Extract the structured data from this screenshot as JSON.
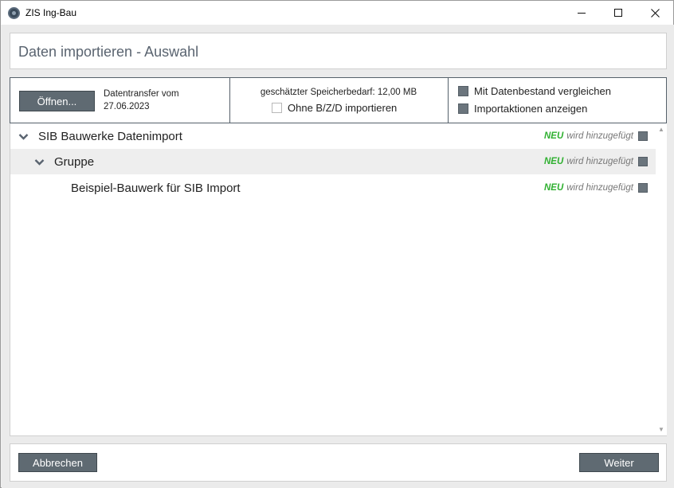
{
  "window": {
    "title": "ZIS Ing-Bau",
    "controls": [
      "minimize",
      "maximize",
      "close"
    ]
  },
  "header": {
    "title": "Daten importieren - Auswahl"
  },
  "toolbar": {
    "open_label": "Öffnen...",
    "transfer_label": "Datentransfer vom",
    "transfer_date": "27.06.2023",
    "storage_text": "geschätzter Speicherbedarf: 12,00 MB",
    "ohne_label": "Ohne B/Z/D importieren",
    "ohne_checked": false,
    "compare_label": "Mit Datenbestand vergleichen",
    "compare_checked": true,
    "actions_label": "Importaktionen anzeigen",
    "actions_checked": true
  },
  "tree": {
    "rows": [
      {
        "label": "SIB Bauwerke Datenimport",
        "level": 0,
        "expanded": true,
        "badge": "NEU",
        "status": "wird hinzugefügt",
        "checked": true
      },
      {
        "label": "Gruppe",
        "level": 1,
        "expanded": true,
        "badge": "NEU",
        "status": "wird hinzugefügt",
        "checked": true
      },
      {
        "label": "Beispiel-Bauwerk für SIB Import",
        "level": 2,
        "expanded": false,
        "badge": "NEU",
        "status": "wird hinzugefügt",
        "checked": true
      }
    ]
  },
  "footer": {
    "cancel_label": "Abbrechen",
    "next_label": "Weiter"
  },
  "colors": {
    "button_bg": "#5f6a72",
    "neu_green": "#2fb030",
    "title_text": "#5a6470"
  }
}
